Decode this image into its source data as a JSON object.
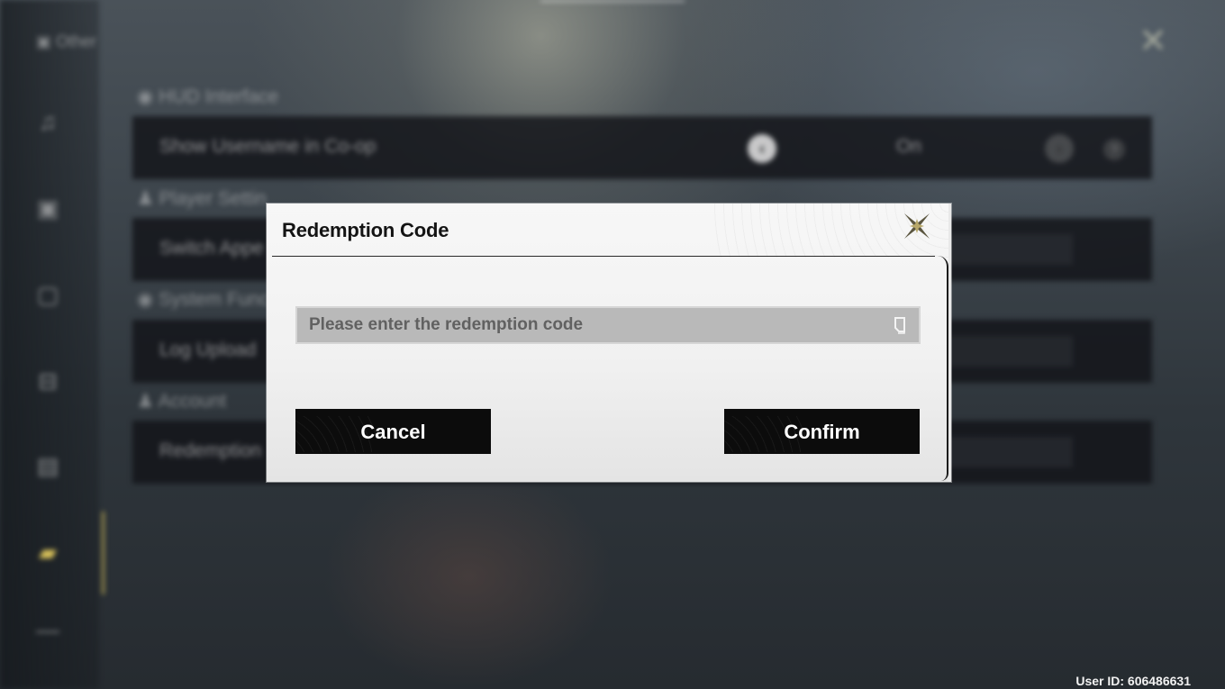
{
  "settings_backdrop": {
    "category": "Other",
    "sections": [
      {
        "title": "HUD Interface",
        "rows": [
          {
            "label": "Show Username in Co-op",
            "value": "On"
          }
        ]
      },
      {
        "title": "Player Settin",
        "rows": [
          {
            "label": "Switch Appe"
          }
        ]
      },
      {
        "title": "System Func",
        "rows": [
          {
            "label": "Log Upload"
          }
        ]
      },
      {
        "title": "Account",
        "rows": [
          {
            "label": "Redemption"
          }
        ]
      }
    ],
    "help_glyph": "?",
    "close_icon": "close-x-icon"
  },
  "dialog": {
    "title": "Redemption Code",
    "close_icon": "close-star-icon",
    "input": {
      "placeholder": "Please enter the redemption code",
      "value": "",
      "paste_icon": "paste-icon"
    },
    "cancel_label": "Cancel",
    "confirm_label": "Confirm"
  },
  "footer": {
    "user_id": "User ID: 606486631"
  },
  "colors": {
    "accent_gold": "#d9c25a",
    "dialog_bg": "#f4f4f4",
    "button_bg": "#0c0c0c",
    "input_bg": "#b9b9b9"
  }
}
